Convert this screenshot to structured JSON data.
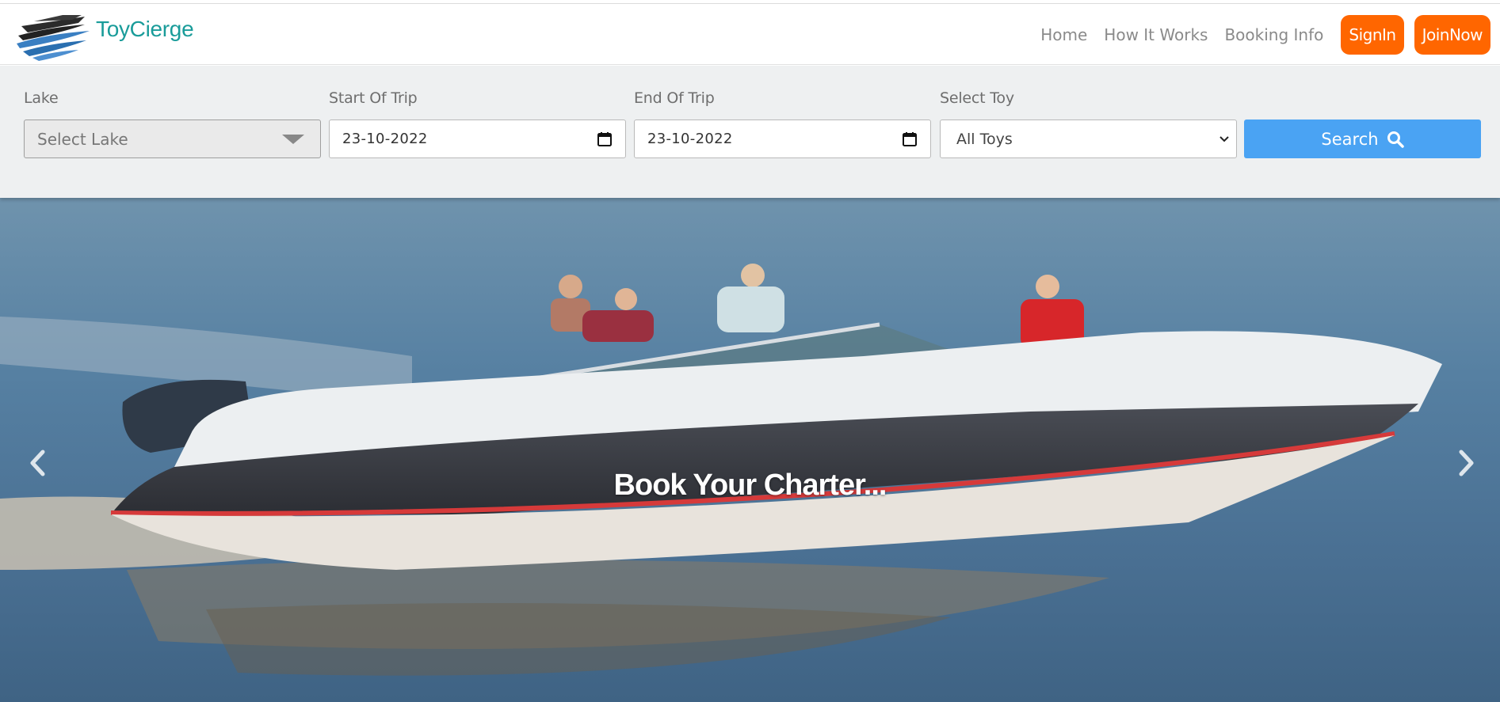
{
  "brand": {
    "name": "ToyCierge",
    "logo_icon": "boat-logo-icon",
    "color": "#1a9c9a"
  },
  "nav": {
    "links": [
      "Home",
      "How It Works",
      "Booking Info"
    ],
    "signin_label": "SignIn",
    "joinnow_label": "JoinNow",
    "accent": "#ff6600"
  },
  "search": {
    "lake": {
      "label": "Lake",
      "placeholder": "Select Lake"
    },
    "start": {
      "label": "Start Of Trip",
      "value": "23-10-2022"
    },
    "end": {
      "label": "End Of Trip",
      "value": "23-10-2022"
    },
    "toy": {
      "label": "Select Toy",
      "value": "All Toys"
    },
    "button_label": "Search",
    "button_icon": "search-icon",
    "button_color": "#4aa3f3"
  },
  "hero": {
    "caption": "Book Your Charter...",
    "prev_icon": "chevron-left-icon",
    "next_icon": "chevron-right-icon"
  }
}
